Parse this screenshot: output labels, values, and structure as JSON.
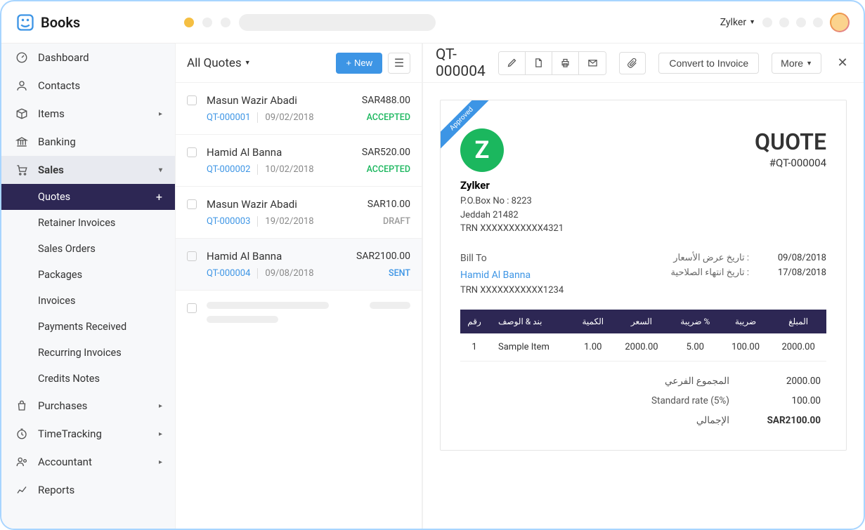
{
  "app_name": "Books",
  "org_name": "Zylker",
  "sidebar": {
    "items": [
      {
        "label": "Dashboard",
        "icon": "dashboard"
      },
      {
        "label": "Contacts",
        "icon": "contacts"
      },
      {
        "label": "Items",
        "icon": "items",
        "expandable": true
      },
      {
        "label": "Banking",
        "icon": "banking"
      },
      {
        "label": "Sales",
        "icon": "sales",
        "expandable": true,
        "expanded": true
      },
      {
        "label": "Purchases",
        "icon": "purchases",
        "expandable": true
      },
      {
        "label": "TimeTracking",
        "icon": "time",
        "expandable": true
      },
      {
        "label": "Accountant",
        "icon": "accountant",
        "expandable": true
      },
      {
        "label": "Reports",
        "icon": "reports"
      }
    ],
    "sales_sub": [
      {
        "label": "Quotes",
        "active": true
      },
      {
        "label": "Retainer Invoices"
      },
      {
        "label": "Sales Orders"
      },
      {
        "label": "Packages"
      },
      {
        "label": "Invoices"
      },
      {
        "label": "Payments Received"
      },
      {
        "label": "Recurring Invoices"
      },
      {
        "label": "Credits Notes"
      }
    ]
  },
  "list": {
    "title": "All Quotes",
    "new_label": "New",
    "quotes": [
      {
        "name": "Masun Wazir Abadi",
        "amount": "SAR488.00",
        "num": "QT-000001",
        "date": "09/02/2018",
        "status": "ACCEPTED",
        "status_class": "accepted"
      },
      {
        "name": "Hamid Al Banna",
        "amount": "SAR520.00",
        "num": "QT-000002",
        "date": "10/02/2018",
        "status": "ACCEPTED",
        "status_class": "accepted"
      },
      {
        "name": "Masun Wazir Abadi",
        "amount": "SAR10.00",
        "num": "QT-000003",
        "date": "19/02/2018",
        "status": "DRAFT",
        "status_class": "draft"
      },
      {
        "name": "Hamid Al Banna",
        "amount": "SAR2100.00",
        "num": "QT-000004",
        "date": "09/08/2018",
        "status": "SENT",
        "status_class": "sent",
        "selected": true
      }
    ]
  },
  "detail": {
    "title": "QT-000004",
    "convert_label": "Convert to Invoice",
    "more_label": "More",
    "ribbon": "Approved",
    "org": {
      "letter": "Z",
      "name": "Zylker",
      "pobox": "P.O.Box No : 8223",
      "city": "Jeddah 21482",
      "trn": "TRN XXXXXXXXXXX4321"
    },
    "doc_label": "QUOTE",
    "doc_num": "#QT-000004",
    "bill_to_label": "Bill To",
    "customer": "Hamid Al Banna",
    "customer_trn": "TRN XXXXXXXXXXX1234",
    "dates": [
      {
        "label": "تاريخ عرض الأسعار :",
        "value": "09/08/2018"
      },
      {
        "label": "تاريخ انتهاء الصلاحية :",
        "value": "17/08/2018"
      }
    ],
    "table": {
      "headers": [
        "رقم",
        "بند & الوصف",
        "الكمية",
        "السعر",
        "ضریبة %",
        "ضریبة",
        "المبلغ"
      ],
      "rows": [
        {
          "idx": "1",
          "item": "Sample Item",
          "qty": "1.00",
          "rate": "2000.00",
          "tax_pct": "5.00",
          "tax": "100.00",
          "amount": "2000.00"
        }
      ]
    },
    "totals": [
      {
        "label": "المجموع الفرعي",
        "value": "2000.00"
      },
      {
        "label": "Standard rate (5%)",
        "value": "100.00"
      },
      {
        "label": "الإجمالي",
        "value": "SAR2100.00",
        "grand": true
      }
    ]
  }
}
